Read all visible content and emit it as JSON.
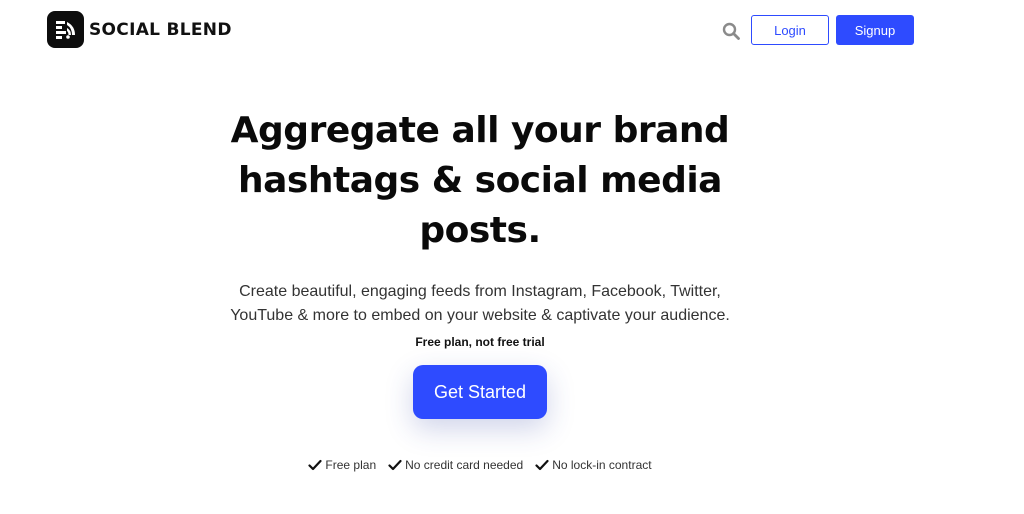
{
  "header": {
    "brand": "SOCIAL BLEND",
    "login_label": "Login",
    "signup_label": "Signup",
    "search_icon": "search-icon"
  },
  "hero": {
    "title": "Aggregate all your brand hashtags & social media posts.",
    "subtitle": "Create beautiful, engaging feeds from Instagram, Facebook, Twitter, YouTube & more to embed on your website & captivate your audience.",
    "note": "Free plan, not free trial",
    "cta_label": "Get Started"
  },
  "features": [
    {
      "label": "Free plan",
      "icon": "check-icon"
    },
    {
      "label": "No credit card needed",
      "icon": "check-icon"
    },
    {
      "label": "No lock-in contract",
      "icon": "check-icon"
    }
  ],
  "colors": {
    "accent": "#2e4bff",
    "text": "#111111",
    "muted": "#333333",
    "background": "#ffffff"
  }
}
